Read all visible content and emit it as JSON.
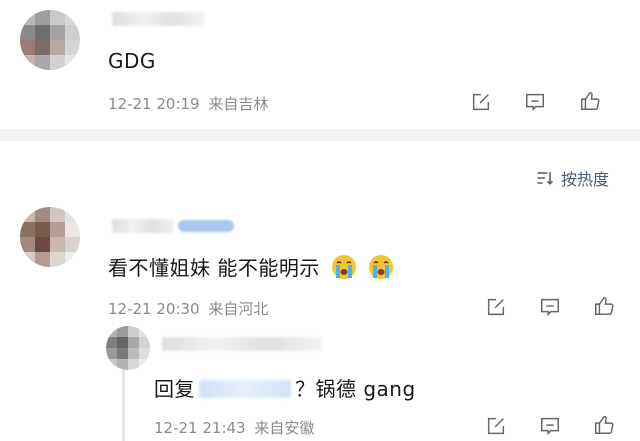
{
  "comments": [
    {
      "text": "GDG",
      "time": "12-21 20:19",
      "location": "来自吉林"
    },
    {
      "text": "看不懂姐妹 能不能明示",
      "time": "12-21 20:30",
      "location": "来自河北"
    }
  ],
  "sort": {
    "label": "按热度"
  },
  "reply": {
    "prefix": "回复",
    "after_mention": "？锅德 gang",
    "time": "12-21 21:43",
    "location": "来自安徽"
  },
  "colors": {
    "meta_text": "#8a8a8a",
    "sort_text": "#4a5c75",
    "divider": "#f3f3f3"
  },
  "icons": [
    "edit-icon",
    "comment-icon",
    "like-icon",
    "sort-icon",
    "crying-emoji"
  ]
}
